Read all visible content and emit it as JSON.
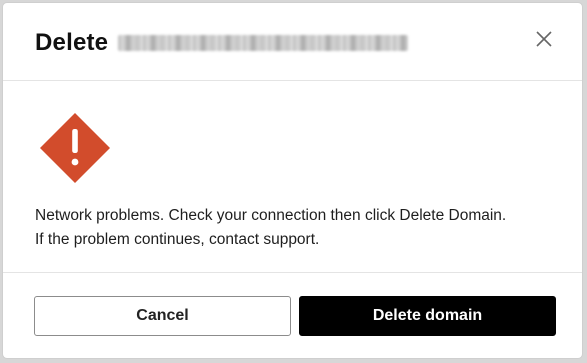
{
  "dialog": {
    "title_prefix": "Delete",
    "title_name_redacted": true,
    "close_icon": "close-icon",
    "warning_icon": "warning-diamond-icon",
    "warning_color": "#d24c2c",
    "message_line1": "Network problems. Check your connection then click Delete Domain.",
    "message_line2": "If the problem continues, contact support.",
    "cancel_label": "Cancel",
    "confirm_label": "Delete domain"
  }
}
